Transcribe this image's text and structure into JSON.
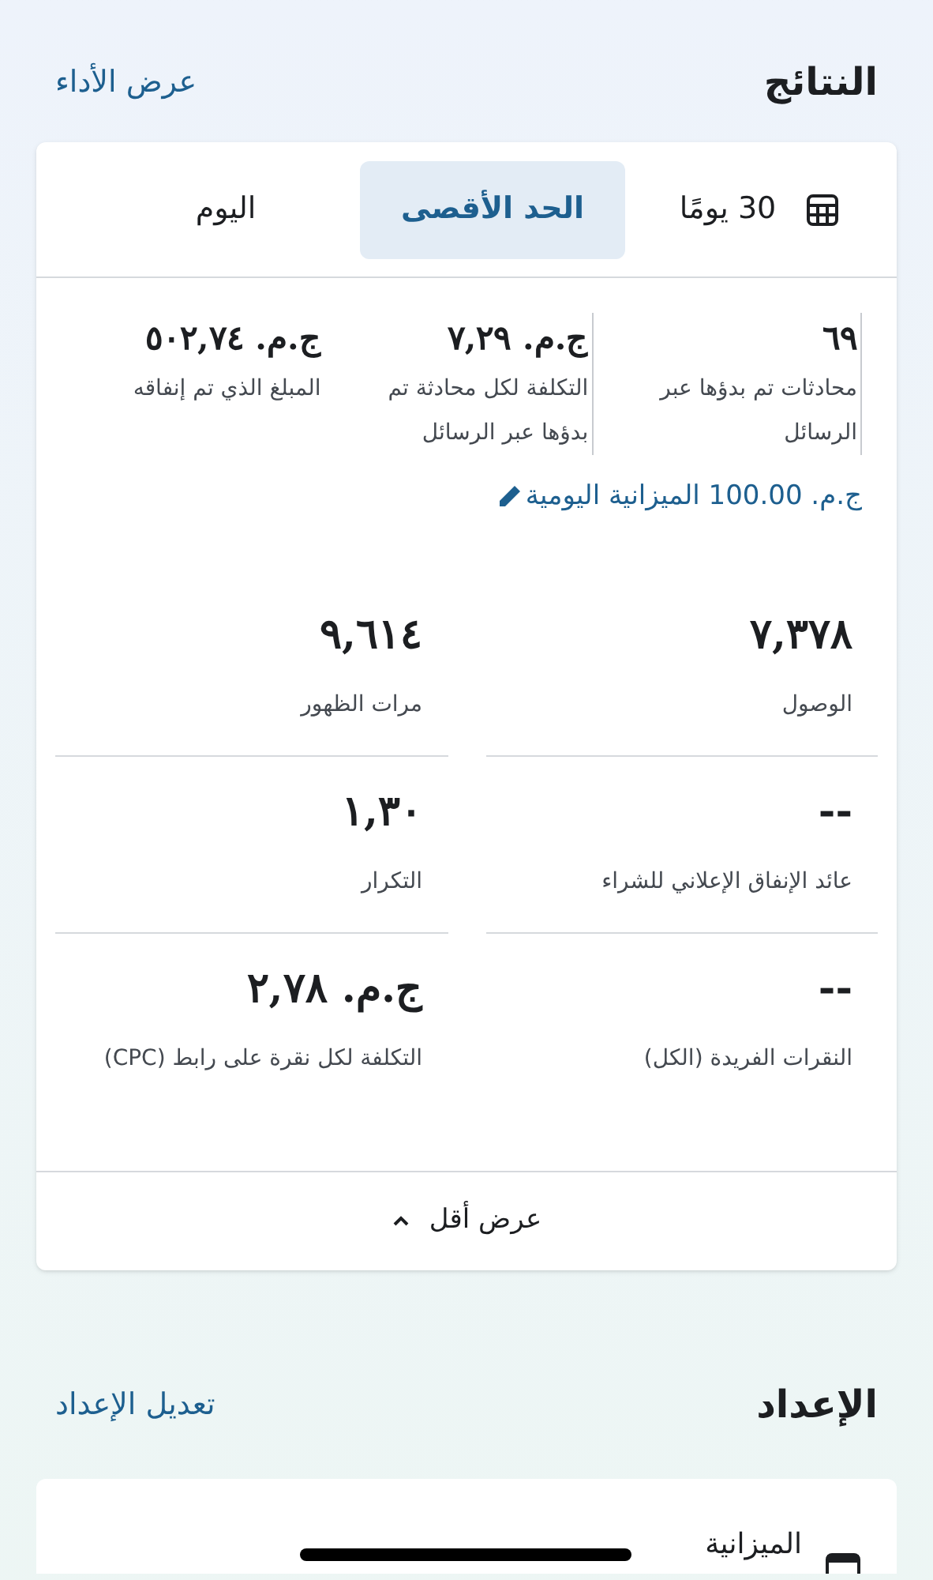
{
  "results": {
    "title": "النتائج",
    "link": "عرض الأداء",
    "tabs": [
      {
        "label": "30 يومًا",
        "kind": "calendar",
        "selected": false
      },
      {
        "label": "الحد الأقصى",
        "kind": "text",
        "selected": true
      },
      {
        "label": "اليوم",
        "kind": "text",
        "selected": false
      }
    ],
    "summary": [
      {
        "value": "٦٩",
        "label": "محادثات تم بدؤها عبر الرسائل"
      },
      {
        "value": "ج.م. ٧,٢٩",
        "label": "التكلفة لكل محادثة تم بدؤها عبر الرسائل"
      },
      {
        "value": "ج.م. ٥٠٢,٧٤",
        "label": "المبلغ الذي تم إنفاقه"
      }
    ],
    "daily_budget": "ج.م. 100.00 الميزانية اليومية",
    "metrics": [
      {
        "value": "٧,٣٧٨",
        "label": "الوصول"
      },
      {
        "value": "٩,٦١٤",
        "label": "مرات الظهور"
      },
      {
        "value": "--",
        "label": "عائد الإنفاق الإعلاني للشراء"
      },
      {
        "value": "١,٣٠",
        "label": "التكرار"
      },
      {
        "value": "--",
        "label": "النقرات الفريدة (الكل)"
      },
      {
        "value": "ج.م. ٢,٧٨",
        "label": "التكلفة لكل نقرة على رابط (CPC)"
      }
    ],
    "show_less": "عرض أقل"
  },
  "setup": {
    "title": "الإعداد",
    "link": "تعديل الإعداد",
    "first_item": "الميزانية"
  }
}
